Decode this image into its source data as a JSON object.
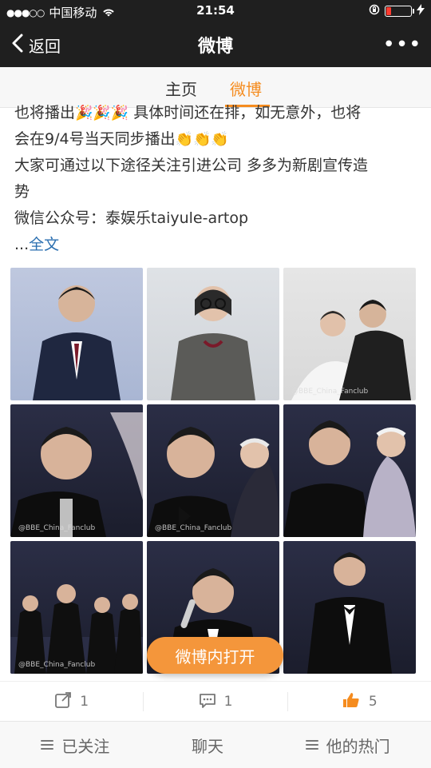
{
  "status": {
    "signal": "●●●○○",
    "carrier": "中国移动",
    "time": "21:54"
  },
  "nav": {
    "back_label": "返回",
    "title": "微博",
    "more_label": "•••"
  },
  "tabs": [
    {
      "label": "主页"
    },
    {
      "label": "微博"
    }
  ],
  "post": {
    "line1_part1": "也将播出",
    "line1_part2": " 具体时间还在排，如无意外，也将",
    "line2": "会在9/4号当天同步播出",
    "line3": "大家可通过以下途径关注引进公司 多多为新剧宣传造",
    "line4": "势",
    "line5": "微信公众号：泰娱乐taiyule-artop",
    "expand_prefix": "...",
    "expand_label": "全文",
    "party_emoji": "🎉🎉🎉",
    "clap_emoji": "👏👏👏"
  },
  "images": [
    {
      "watermark": ""
    },
    {
      "watermark": ""
    },
    {
      "watermark": "@BBE_China_Fanclub"
    },
    {
      "watermark": "@BBE_China_Fanclub"
    },
    {
      "watermark": "@BBE_China_Fanclub"
    },
    {
      "watermark": ""
    },
    {
      "watermark": "@BBE_China_Fanclub"
    },
    {
      "watermark": ""
    },
    {
      "watermark": ""
    }
  ],
  "open_button": {
    "label": "微博内打开"
  },
  "actions": {
    "repost_count": "1",
    "comment_count": "1",
    "like_count": "5"
  },
  "bottom_tabs": [
    {
      "label": "已关注"
    },
    {
      "label": "聊天"
    },
    {
      "label": "他的热门"
    }
  ]
}
